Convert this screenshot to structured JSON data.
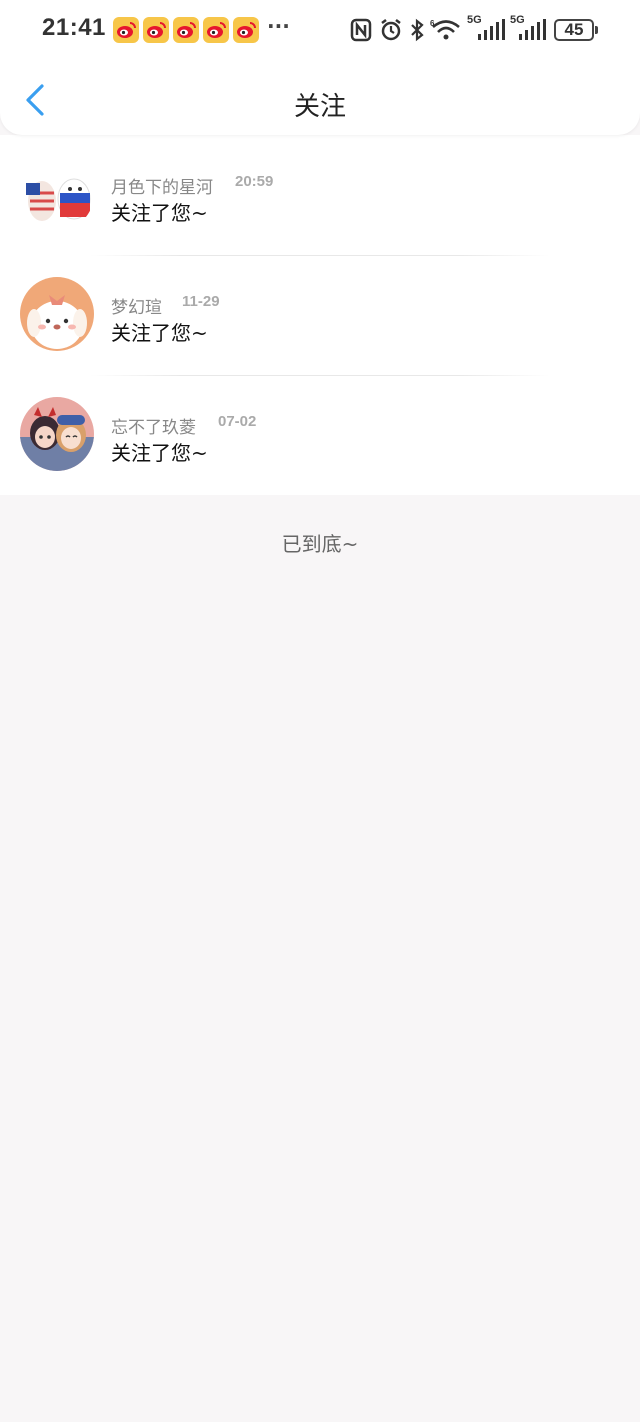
{
  "status_bar": {
    "time": "21:41",
    "notification_icons": [
      "weibo-icon",
      "weibo-icon",
      "weibo-icon",
      "weibo-icon",
      "weibo-icon"
    ],
    "more": "···",
    "network_label_1": "5G",
    "network_label_2": "5G",
    "battery": "45"
  },
  "header": {
    "title": "关注",
    "back_icon": "chevron-left-icon",
    "accent_color": "#3a9ff0"
  },
  "notifications": [
    {
      "name": "月色下的星河",
      "date": "20:59",
      "message": "关注了您~"
    },
    {
      "name": "梦幻瑄",
      "date": "11-29",
      "message": "关注了您~"
    },
    {
      "name": "忘不了玖菱",
      "date": "07-02",
      "message": "关注了您~"
    }
  ],
  "footer": {
    "end_text": "已到底~"
  }
}
